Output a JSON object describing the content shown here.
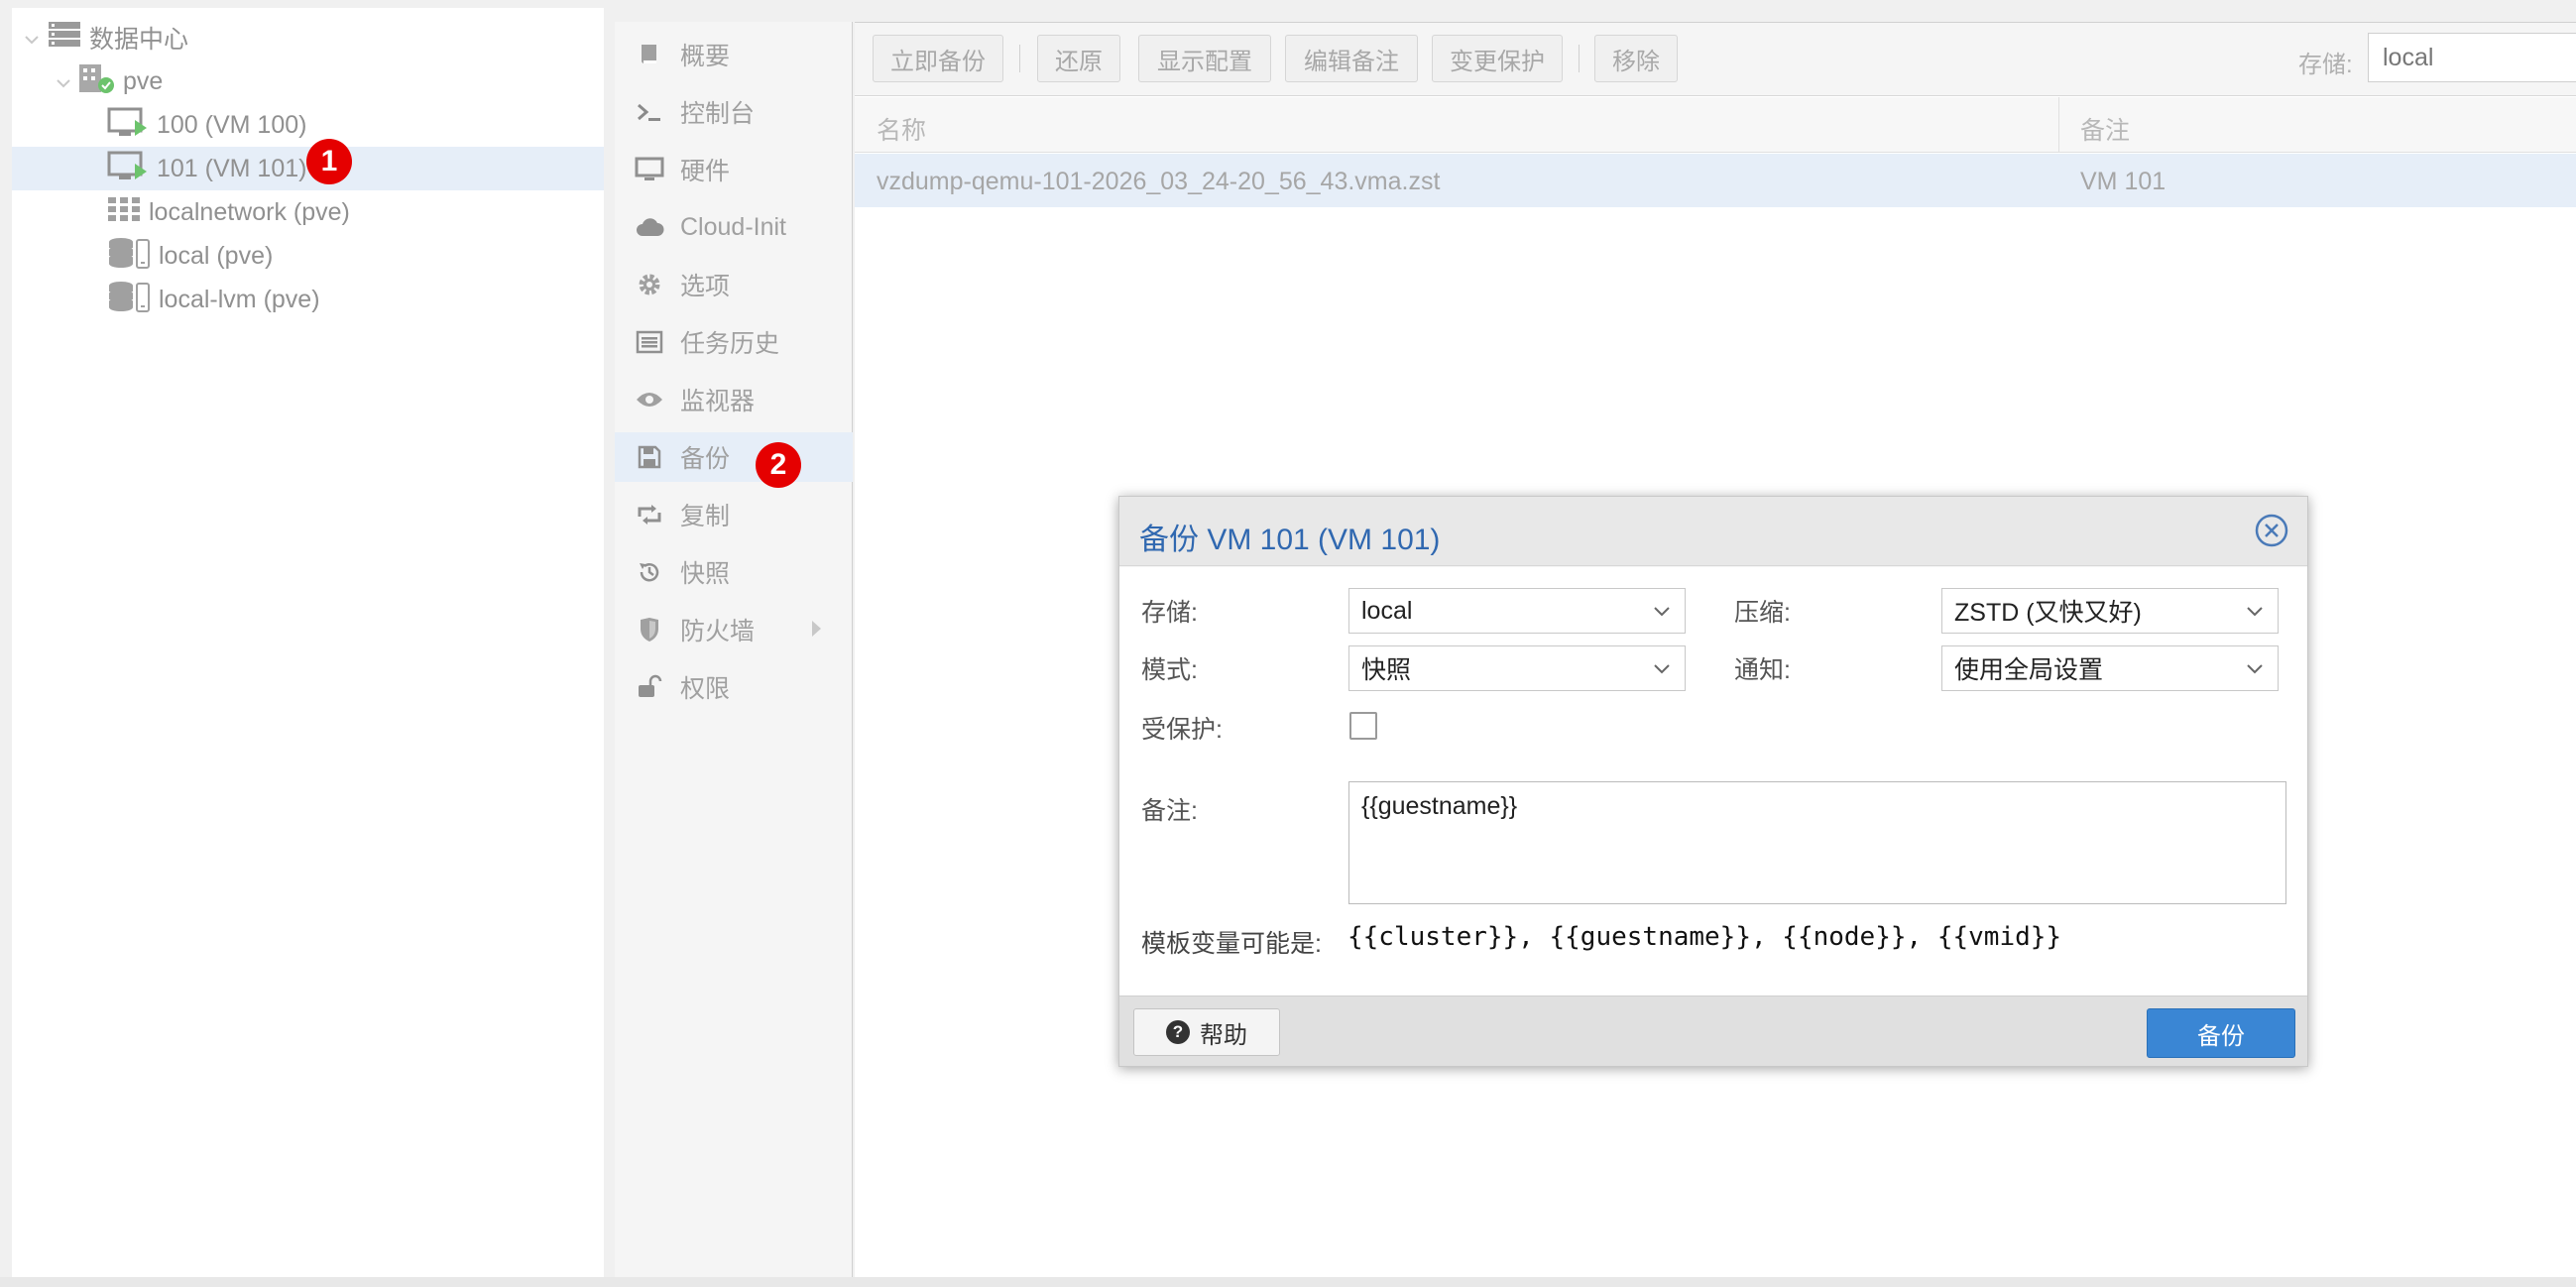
{
  "tree": {
    "datacenter": "数据中心",
    "node": "pve",
    "items": [
      {
        "label": "100 (VM 100)",
        "icon": "vm-running-icon"
      },
      {
        "label": "101 (VM 101)",
        "icon": "vm-running-icon"
      },
      {
        "label": "localnetwork (pve)",
        "icon": "sdn-grid-icon"
      },
      {
        "label": "local (pve)",
        "icon": "storage-icon"
      },
      {
        "label": "local-lvm (pve)",
        "icon": "storage-icon"
      }
    ]
  },
  "badges": {
    "one": "1",
    "two": "2"
  },
  "menu": {
    "items": [
      {
        "label": "概要",
        "icon": "book-icon"
      },
      {
        "label": "控制台",
        "icon": "terminal-icon"
      },
      {
        "label": "硬件",
        "icon": "monitor-icon"
      },
      {
        "label": "Cloud-Init",
        "icon": "cloud-icon"
      },
      {
        "label": "选项",
        "icon": "gear-icon"
      },
      {
        "label": "任务历史",
        "icon": "list-icon"
      },
      {
        "label": "监视器",
        "icon": "eye-icon"
      },
      {
        "label": "备份",
        "icon": "floppy-icon"
      },
      {
        "label": "复制",
        "icon": "retweet-icon"
      },
      {
        "label": "快照",
        "icon": "history-icon"
      },
      {
        "label": "防火墙",
        "icon": "shield-icon"
      },
      {
        "label": "权限",
        "icon": "unlock-icon"
      }
    ]
  },
  "toolbar": {
    "backup_now": "立即备份",
    "restore": "还原",
    "show_config": "显示配置",
    "edit_notes": "编辑备注",
    "change_protection": "变更保护",
    "remove": "移除",
    "storage_label": "存储:",
    "storage_value": "local"
  },
  "grid": {
    "col_name": "名称",
    "col_notes": "备注",
    "rows": [
      {
        "name": "vzdump-qemu-101-2026_03_24-20_56_43.vma.zst",
        "notes": "VM 101"
      }
    ]
  },
  "dialog": {
    "title": "备份 VM 101 (VM 101)",
    "storage_label": "存储:",
    "storage_value": "local",
    "compression_label": "压缩:",
    "compression_value": "ZSTD (又快又好)",
    "mode_label": "模式:",
    "mode_value": "快照",
    "notify_label": "通知:",
    "notify_value": "使用全局设置",
    "protected_label": "受保护:",
    "notes_label": "备注:",
    "notes_value": "{{guestname}}",
    "hint_label": "模板变量可能是:",
    "hint_vars": "{{cluster}}, {{guestname}}, {{node}}, {{vmid}}",
    "help_label": "帮助",
    "backup_label": "备份"
  },
  "colors": {
    "accent": "#3a86d4",
    "title": "#3068b0",
    "selected_row": "#e6eef8",
    "badge": "#e50000",
    "running": "#6cc36c"
  }
}
